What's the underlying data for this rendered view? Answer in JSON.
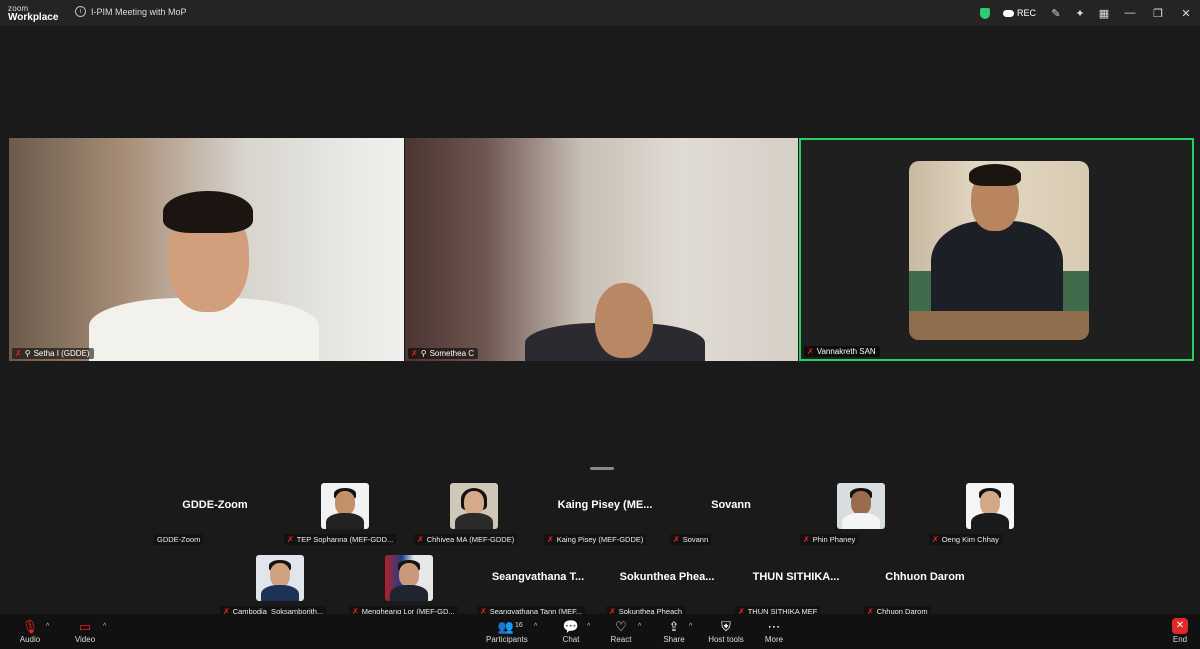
{
  "app": {
    "logo_top": "zoom",
    "logo_bottom": "Workplace",
    "meeting_title": "I-PIM Meeting with MoP"
  },
  "titlebar": {
    "rec_label": "REC"
  },
  "tiles": [
    {
      "name": "Setha I (GDDE)"
    },
    {
      "name": "Somethea C"
    },
    {
      "name": "Vannakreth SAN"
    }
  ],
  "gallery_row1": [
    {
      "big": "GDDE-Zoom",
      "caption": "GDDE-Zoom"
    },
    {
      "big": "",
      "caption": "TEP Sophanna (MEF-GDD..."
    },
    {
      "big": "",
      "caption": "Chhivea MA (MEF-GDDE)"
    },
    {
      "big": "Kaing  Pisey  (ME...",
      "caption": "Kaing Pisey (MEF-GDDE)"
    },
    {
      "big": "Sovann",
      "caption": "Sovann"
    },
    {
      "big": "",
      "caption": "Phin Phaney"
    },
    {
      "big": "",
      "caption": "Oeng Kim Chhay"
    }
  ],
  "gallery_row2": [
    {
      "big": "",
      "caption": "Cambodia_Soksamborith..."
    },
    {
      "big": "",
      "caption": "Mengheang Lor (MEF-GD..."
    },
    {
      "big": "Seangvathana  T...",
      "caption": "Seangvathana Tann (MEF..."
    },
    {
      "big": "Sokunthea  Phea...",
      "caption": "Sokunthea Pheach"
    },
    {
      "big": "THUN  SITHIKA...",
      "caption": "THUN SITHIKA MEF"
    },
    {
      "big": "Chhuon Darom",
      "caption": "Chhuon Darom"
    }
  ],
  "toolbar": {
    "audio": "Audio",
    "video": "Video",
    "participants": "Participants",
    "participants_count": "16",
    "chat": "Chat",
    "react": "React",
    "share": "Share",
    "host_tools": "Host tools",
    "more": "More",
    "end": "End"
  },
  "colors": {
    "active_speaker": "#23d160",
    "end_button": "#e02828",
    "muted_mic": "#ee2222"
  }
}
